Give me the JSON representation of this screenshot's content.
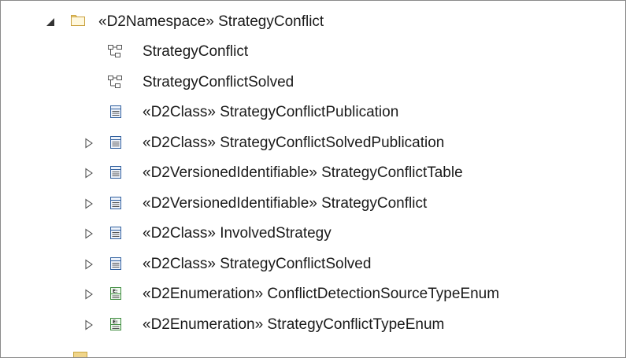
{
  "tree": {
    "root": {
      "label": "«D2Namespace» StrategyConflict",
      "expanded": true,
      "icon": "folder-icon"
    },
    "items": [
      {
        "label": "StrategyConflict",
        "icon": "diagram-icon",
        "expandable": false
      },
      {
        "label": "StrategyConflictSolved",
        "icon": "diagram-icon",
        "expandable": false
      },
      {
        "label": "«D2Class» StrategyConflictPublication",
        "icon": "class-icon",
        "expandable": false
      },
      {
        "label": "«D2Class» StrategyConflictSolvedPublication",
        "icon": "class-icon",
        "expandable": true
      },
      {
        "label": "«D2VersionedIdentifiable» StrategyConflictTable",
        "icon": "class-icon",
        "expandable": true
      },
      {
        "label": "«D2VersionedIdentifiable» StrategyConflict",
        "icon": "class-icon",
        "expandable": true
      },
      {
        "label": "«D2Class» InvolvedStrategy",
        "icon": "class-icon",
        "expandable": true
      },
      {
        "label": "«D2Class» StrategyConflictSolved",
        "icon": "class-icon",
        "expandable": true
      },
      {
        "label": "«D2Enumeration» ConflictDetectionSourceTypeEnum",
        "icon": "enumeration-icon",
        "expandable": true
      },
      {
        "label": "«D2Enumeration» StrategyConflictTypeEnum",
        "icon": "enumeration-icon",
        "expandable": true
      }
    ]
  },
  "colors": {
    "folder_fill": "#fbe7a8",
    "folder_stroke": "#c9a03c",
    "class_stroke": "#2f5f9e",
    "enum_stroke": "#3b8a3b",
    "twisty": "#333333"
  }
}
